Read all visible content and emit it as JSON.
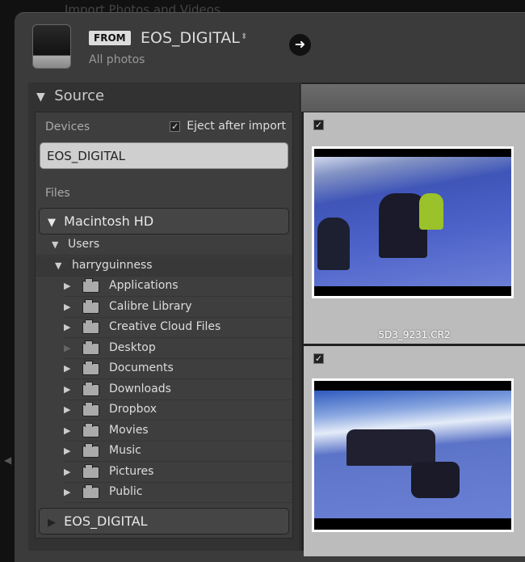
{
  "window_title": "Import Photos and Videos",
  "header": {
    "from_label": "FROM",
    "source": "EOS_DIGITAL",
    "subtitle": "All photos"
  },
  "source_panel": {
    "title": "Source",
    "devices_label": "Devices",
    "eject_label": "Eject after import",
    "eject_checked": true,
    "device": "EOS_DIGITAL",
    "files_label": "Files",
    "volume": "Macintosh HD",
    "users": "Users",
    "user": "harryguinness",
    "folders": [
      "Applications",
      "Calibre Library",
      "Creative Cloud Files",
      "Desktop",
      "Documents",
      "Downloads",
      "Dropbox",
      "Movies",
      "Music",
      "Pictures",
      "Public"
    ],
    "bottom_volume": "EOS_DIGITAL"
  },
  "grid": {
    "items": [
      {
        "filename": "5D3_9231.CR2",
        "checked": true
      },
      {
        "filename": "",
        "checked": true
      }
    ]
  }
}
